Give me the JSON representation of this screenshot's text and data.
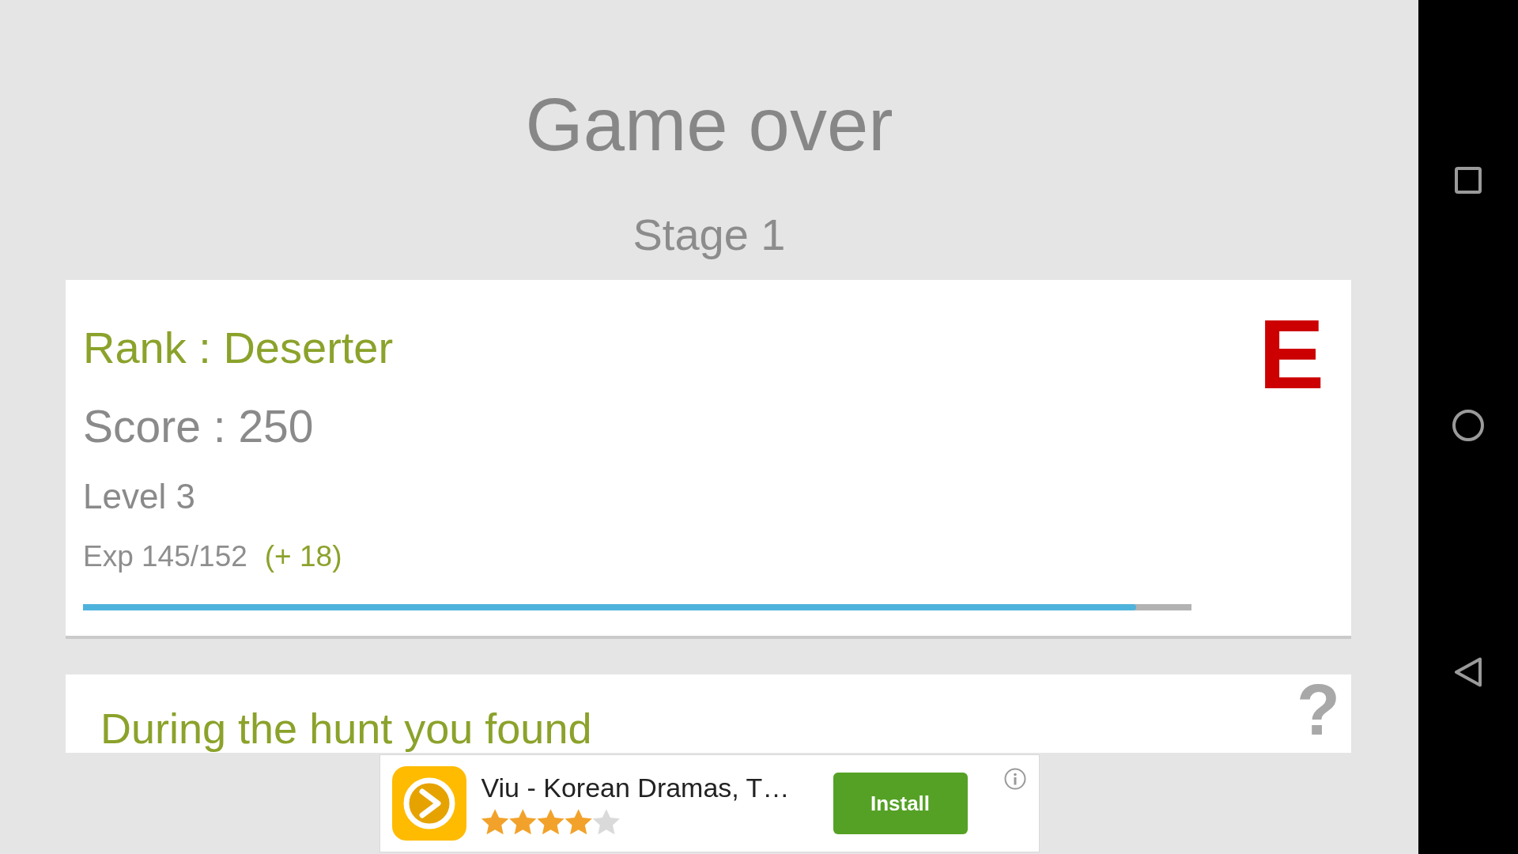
{
  "title": "Game over",
  "stage": "Stage 1",
  "result_card": {
    "rank": "Rank : Deserter",
    "score": "Score : 250",
    "level_label": "Level 3",
    "exp": "Exp 145/152",
    "exp_gain": "(+ 18)",
    "exp_bar": {
      "level": 0.95
    },
    "grade": "E"
  },
  "loot_card": {
    "heading": "During the hunt you found",
    "help": "?"
  },
  "ad": {
    "title": "Viu - Korean Dramas, T…",
    "stars": 4,
    "button": "Install"
  }
}
